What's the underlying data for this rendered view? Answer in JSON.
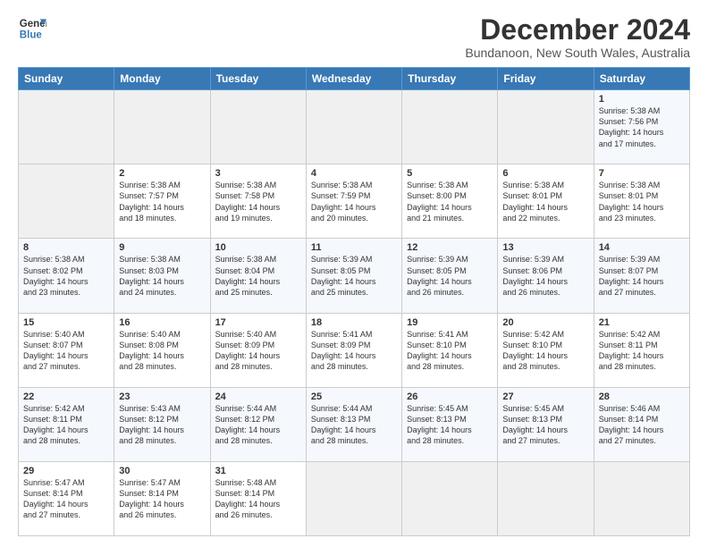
{
  "header": {
    "logo_line1": "General",
    "logo_line2": "Blue",
    "title": "December 2024",
    "subtitle": "Bundanoon, New South Wales, Australia"
  },
  "calendar": {
    "headers": [
      "Sunday",
      "Monday",
      "Tuesday",
      "Wednesday",
      "Thursday",
      "Friday",
      "Saturday"
    ],
    "weeks": [
      [
        {
          "day": "",
          "info": ""
        },
        {
          "day": "",
          "info": ""
        },
        {
          "day": "",
          "info": ""
        },
        {
          "day": "",
          "info": ""
        },
        {
          "day": "",
          "info": ""
        },
        {
          "day": "",
          "info": ""
        },
        {
          "day": "1",
          "info": "Sunrise: 5:38 AM\nSunset: 7:56 PM\nDaylight: 14 hours\nand 17 minutes."
        }
      ],
      [
        {
          "day": "",
          "info": ""
        },
        {
          "day": "2",
          "info": "Sunrise: 5:38 AM\nSunset: 7:57 PM\nDaylight: 14 hours\nand 18 minutes."
        },
        {
          "day": "3",
          "info": "Sunrise: 5:38 AM\nSunset: 7:58 PM\nDaylight: 14 hours\nand 19 minutes."
        },
        {
          "day": "4",
          "info": "Sunrise: 5:38 AM\nSunset: 7:59 PM\nDaylight: 14 hours\nand 20 minutes."
        },
        {
          "day": "5",
          "info": "Sunrise: 5:38 AM\nSunset: 8:00 PM\nDaylight: 14 hours\nand 21 minutes."
        },
        {
          "day": "6",
          "info": "Sunrise: 5:38 AM\nSunset: 8:01 PM\nDaylight: 14 hours\nand 22 minutes."
        },
        {
          "day": "7",
          "info": "Sunrise: 5:38 AM\nSunset: 8:01 PM\nDaylight: 14 hours\nand 23 minutes."
        }
      ],
      [
        {
          "day": "8",
          "info": "Sunrise: 5:38 AM\nSunset: 8:02 PM\nDaylight: 14 hours\nand 23 minutes."
        },
        {
          "day": "9",
          "info": "Sunrise: 5:38 AM\nSunset: 8:03 PM\nDaylight: 14 hours\nand 24 minutes."
        },
        {
          "day": "10",
          "info": "Sunrise: 5:38 AM\nSunset: 8:04 PM\nDaylight: 14 hours\nand 25 minutes."
        },
        {
          "day": "11",
          "info": "Sunrise: 5:39 AM\nSunset: 8:05 PM\nDaylight: 14 hours\nand 25 minutes."
        },
        {
          "day": "12",
          "info": "Sunrise: 5:39 AM\nSunset: 8:05 PM\nDaylight: 14 hours\nand 26 minutes."
        },
        {
          "day": "13",
          "info": "Sunrise: 5:39 AM\nSunset: 8:06 PM\nDaylight: 14 hours\nand 26 minutes."
        },
        {
          "day": "14",
          "info": "Sunrise: 5:39 AM\nSunset: 8:07 PM\nDaylight: 14 hours\nand 27 minutes."
        }
      ],
      [
        {
          "day": "15",
          "info": "Sunrise: 5:40 AM\nSunset: 8:07 PM\nDaylight: 14 hours\nand 27 minutes."
        },
        {
          "day": "16",
          "info": "Sunrise: 5:40 AM\nSunset: 8:08 PM\nDaylight: 14 hours\nand 28 minutes."
        },
        {
          "day": "17",
          "info": "Sunrise: 5:40 AM\nSunset: 8:09 PM\nDaylight: 14 hours\nand 28 minutes."
        },
        {
          "day": "18",
          "info": "Sunrise: 5:41 AM\nSunset: 8:09 PM\nDaylight: 14 hours\nand 28 minutes."
        },
        {
          "day": "19",
          "info": "Sunrise: 5:41 AM\nSunset: 8:10 PM\nDaylight: 14 hours\nand 28 minutes."
        },
        {
          "day": "20",
          "info": "Sunrise: 5:42 AM\nSunset: 8:10 PM\nDaylight: 14 hours\nand 28 minutes."
        },
        {
          "day": "21",
          "info": "Sunrise: 5:42 AM\nSunset: 8:11 PM\nDaylight: 14 hours\nand 28 minutes."
        }
      ],
      [
        {
          "day": "22",
          "info": "Sunrise: 5:42 AM\nSunset: 8:11 PM\nDaylight: 14 hours\nand 28 minutes."
        },
        {
          "day": "23",
          "info": "Sunrise: 5:43 AM\nSunset: 8:12 PM\nDaylight: 14 hours\nand 28 minutes."
        },
        {
          "day": "24",
          "info": "Sunrise: 5:44 AM\nSunset: 8:12 PM\nDaylight: 14 hours\nand 28 minutes."
        },
        {
          "day": "25",
          "info": "Sunrise: 5:44 AM\nSunset: 8:13 PM\nDaylight: 14 hours\nand 28 minutes."
        },
        {
          "day": "26",
          "info": "Sunrise: 5:45 AM\nSunset: 8:13 PM\nDaylight: 14 hours\nand 28 minutes."
        },
        {
          "day": "27",
          "info": "Sunrise: 5:45 AM\nSunset: 8:13 PM\nDaylight: 14 hours\nand 27 minutes."
        },
        {
          "day": "28",
          "info": "Sunrise: 5:46 AM\nSunset: 8:14 PM\nDaylight: 14 hours\nand 27 minutes."
        }
      ],
      [
        {
          "day": "29",
          "info": "Sunrise: 5:47 AM\nSunset: 8:14 PM\nDaylight: 14 hours\nand 27 minutes."
        },
        {
          "day": "30",
          "info": "Sunrise: 5:47 AM\nSunset: 8:14 PM\nDaylight: 14 hours\nand 26 minutes."
        },
        {
          "day": "31",
          "info": "Sunrise: 5:48 AM\nSunset: 8:14 PM\nDaylight: 14 hours\nand 26 minutes."
        },
        {
          "day": "",
          "info": ""
        },
        {
          "day": "",
          "info": ""
        },
        {
          "day": "",
          "info": ""
        },
        {
          "day": "",
          "info": ""
        }
      ]
    ]
  }
}
